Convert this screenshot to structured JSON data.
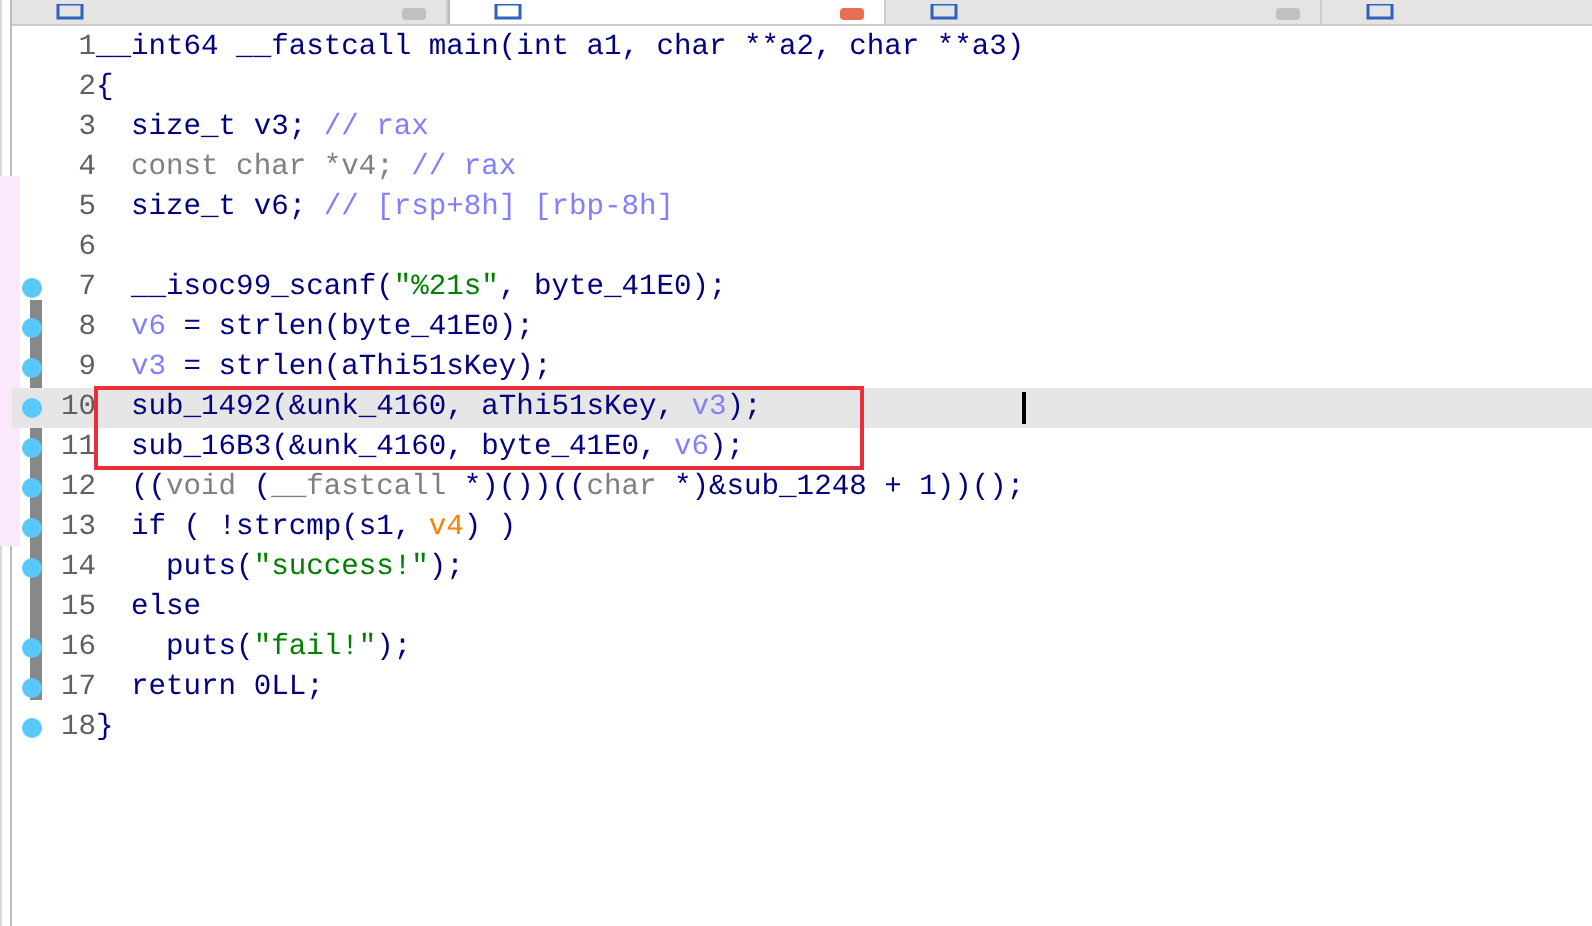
{
  "tabs": [
    {
      "selected": false
    },
    {
      "selected": true
    },
    {
      "selected": false
    },
    {
      "selected": false
    }
  ],
  "lines": [
    {
      "num": "1",
      "dot": false,
      "selected": false,
      "tokens": [
        {
          "kind": "t",
          "text": "__int64 __fastcall main(int a1, char **a2, char **a3)"
        }
      ]
    },
    {
      "num": "2",
      "dot": false,
      "selected": false,
      "tokens": [
        {
          "kind": "t",
          "text": "{"
        }
      ]
    },
    {
      "num": "3",
      "dot": false,
      "selected": false,
      "tokens": [
        {
          "kind": "t",
          "text": "  size_t v3; "
        },
        {
          "kind": "l",
          "text": "// rax"
        }
      ]
    },
    {
      "num": "4",
      "dot": false,
      "selected": false,
      "tokens": [
        {
          "kind": "g",
          "text": "  const char *v4; "
        },
        {
          "kind": "l",
          "text": "// rax"
        }
      ]
    },
    {
      "num": "5",
      "dot": false,
      "selected": false,
      "tokens": [
        {
          "kind": "t",
          "text": "  size_t v6; "
        },
        {
          "kind": "l",
          "text": "// [rsp+8h] [rbp-8h]"
        }
      ]
    },
    {
      "num": "6",
      "dot": false,
      "selected": false
    },
    {
      "num": "7",
      "dot": true,
      "selected": false,
      "tokens": [
        {
          "kind": "t",
          "text": "  __isoc99_scanf("
        },
        {
          "kind": "s",
          "text": "\"%21s\""
        },
        {
          "kind": "t",
          "text": ", byte_41E0);"
        }
      ]
    },
    {
      "num": "8",
      "dot": true,
      "selected": false,
      "tokens": [
        {
          "kind": "l",
          "text": "  v6"
        },
        {
          "kind": "t",
          "text": " = strlen(byte_41E0);"
        }
      ]
    },
    {
      "num": "9",
      "dot": true,
      "selected": false,
      "tokens": [
        {
          "kind": "l",
          "text": "  v3"
        },
        {
          "kind": "t",
          "text": " = strlen(aThi51sKey);"
        }
      ]
    },
    {
      "num": "10",
      "dot": true,
      "selected": true,
      "tokens": [
        {
          "kind": "t",
          "text": "  sub_1492(&unk_4160, aThi51sKey, "
        },
        {
          "kind": "l",
          "text": "v3"
        },
        {
          "kind": "t",
          "text": ");"
        }
      ]
    },
    {
      "num": "11",
      "dot": true,
      "selected": false,
      "tokens": [
        {
          "kind": "t",
          "text": "  sub_16B3(&unk_4160, byte_41E0, "
        },
        {
          "kind": "l",
          "text": "v6"
        },
        {
          "kind": "t",
          "text": ");"
        }
      ]
    },
    {
      "num": "12",
      "dot": true,
      "selected": false,
      "tokens": [
        {
          "kind": "t",
          "text": "  (("
        },
        {
          "kind": "g",
          "text": "void"
        },
        {
          "kind": "t",
          "text": " ("
        },
        {
          "kind": "g",
          "text": "__fastcall"
        },
        {
          "kind": "t",
          "text": " *)())(("
        },
        {
          "kind": "g",
          "text": "char"
        },
        {
          "kind": "t",
          "text": " *)&sub_1248 + 1))();"
        }
      ]
    },
    {
      "num": "13",
      "dot": true,
      "selected": false,
      "tokens": [
        {
          "kind": "t",
          "text": "  if ( !strcmp(s1, "
        },
        {
          "kind": "o",
          "text": "v4"
        },
        {
          "kind": "t",
          "text": ") )"
        }
      ]
    },
    {
      "num": "14",
      "dot": true,
      "selected": false,
      "tokens": [
        {
          "kind": "t",
          "text": "    puts("
        },
        {
          "kind": "s",
          "text": "\"success!\""
        },
        {
          "kind": "t",
          "text": ");"
        }
      ]
    },
    {
      "num": "15",
      "dot": false,
      "selected": false,
      "tokens": [
        {
          "kind": "t",
          "text": "  else"
        }
      ]
    },
    {
      "num": "16",
      "dot": true,
      "selected": false,
      "tokens": [
        {
          "kind": "t",
          "text": "    puts("
        },
        {
          "kind": "s",
          "text": "\"fail!\""
        },
        {
          "kind": "t",
          "text": ");"
        }
      ]
    },
    {
      "num": "17",
      "dot": true,
      "selected": false,
      "tokens": [
        {
          "kind": "t",
          "text": "  return 0LL;"
        }
      ]
    },
    {
      "num": "18",
      "dot": true,
      "selected": false,
      "tokens": [
        {
          "kind": "t",
          "text": "}"
        }
      ]
    }
  ]
}
